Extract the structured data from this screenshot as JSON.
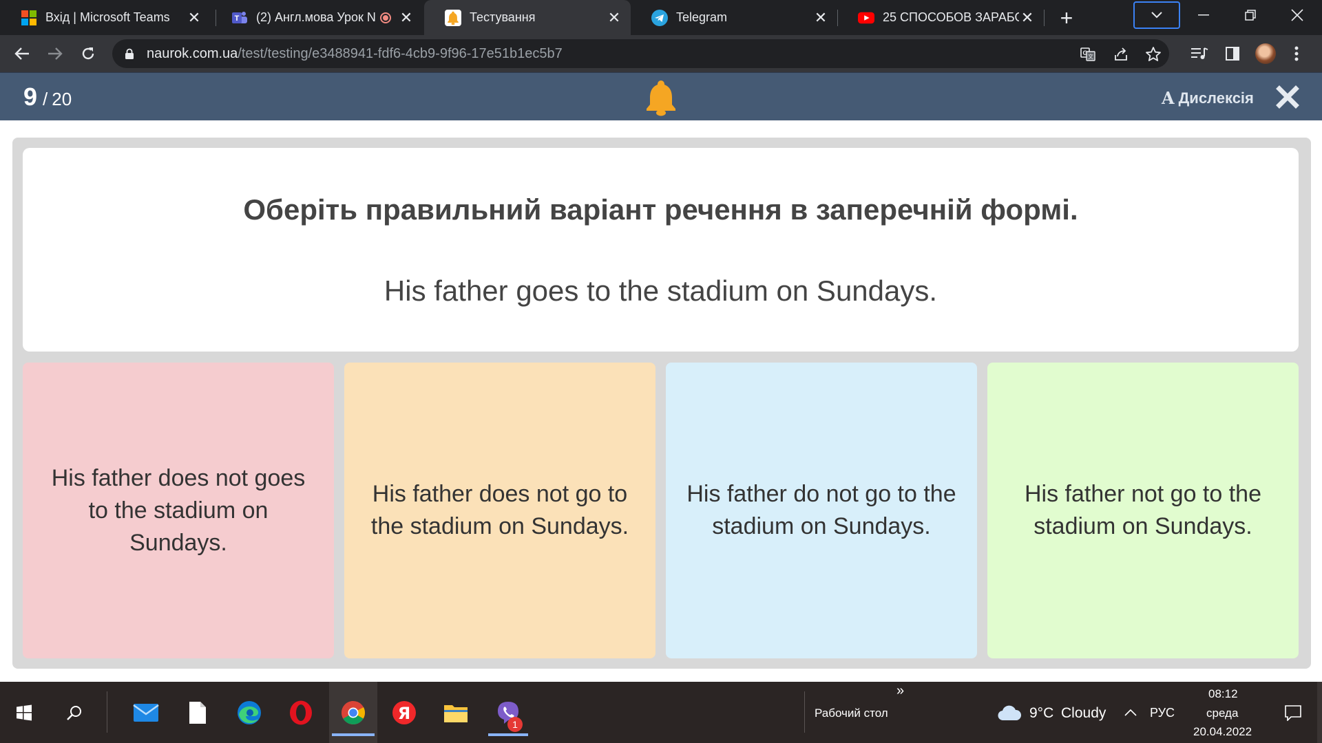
{
  "browser": {
    "tabs": [
      {
        "title": "Вхід | Microsoft Teams",
        "icon": "microsoft-logo-icon"
      },
      {
        "title": "(2) Англ.мова Урок N",
        "icon": "teams-icon"
      },
      {
        "title": "Тестування",
        "icon": "naurok-bell-icon"
      },
      {
        "title": "Telegram",
        "icon": "telegram-icon"
      },
      {
        "title": "25 СПОСОБОВ ЗАРАБОТ",
        "icon": "youtube-icon"
      }
    ],
    "active_tab_index": 2,
    "url_host": "naurok.com.ua",
    "url_path": "/test/testing/e3488941-fdf6-4cb9-9f96-17e51b1ec5b7"
  },
  "quiz": {
    "current": "9",
    "separator": "/",
    "total": "20",
    "dyslexia_icon_letter": "A",
    "dyslexia_label": "Дислексія",
    "instruction": "Оберіть правильний варіант речення в заперечній формі.",
    "question": "His father goes to the stadium on Sundays.",
    "answers": [
      {
        "text": "His father does not goes to the stadium on Sundays.",
        "color": "#f5cccf"
      },
      {
        "text": "His father does not go to the stadium on Sundays.",
        "color": "#fbe1b8"
      },
      {
        "text": "His father do not go to the stadium on Sundays.",
        "color": "#d8effa"
      },
      {
        "text": "His father not go to the stadium on Sundays.",
        "color": "#e1fccf"
      }
    ],
    "colors": {
      "header": "#455a74",
      "bell": "#f5a623"
    }
  },
  "taskbar": {
    "desktop_label": "Рабочий стол",
    "expand_glyph": "»",
    "weather_temp": "9°C",
    "weather_text": "Cloudy",
    "language": "РУС",
    "time": "08:12",
    "day": "среда",
    "date": "20.04.2022",
    "viber_badge": "1"
  }
}
